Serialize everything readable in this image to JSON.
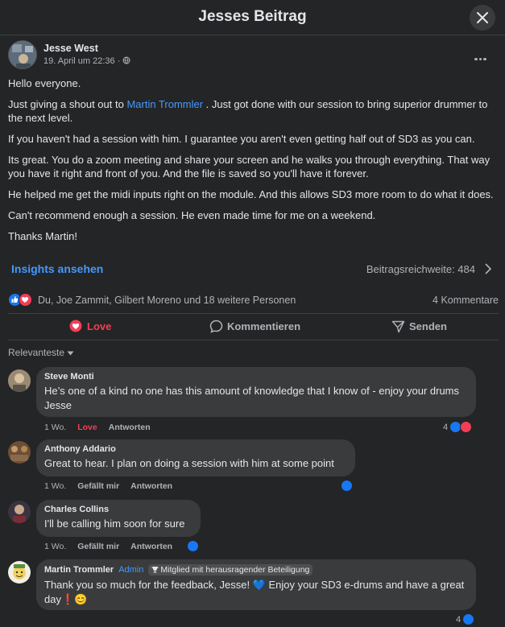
{
  "dialog": {
    "title": "Jesses Beitrag"
  },
  "post": {
    "author": "Jesse West",
    "time": "19. April um 22:36 ·",
    "paragraphs": {
      "p1": "Hello everyone.",
      "p2_before": "Just giving a shout out to ",
      "p2_mention": "Martin Trommler",
      "p2_after": " . Just got done with our session to bring superior drummer to the next level.",
      "p3": "If you haven't had a session with him. I guarantee you aren't even getting half out of SD3 as you can.",
      "p4": "Its great. You do a zoom meeting and share your screen and he walks you through everything. That way you have it right and front of you. And the file is saved so you'll have it forever.",
      "p5": "He helped me get the midi inputs right on the module. And this allows SD3 more room to do what it does.",
      "p6": "Can't recommend enough a session. He even made time for me on a weekend.",
      "p7": "Thanks Martin!"
    },
    "insights_label": "Insights ansehen",
    "reach_label": "Beitragsreichweite: 484",
    "reactions_text": "Du, Joe Zammit, Gilbert Moreno und 18 weitere Personen",
    "comments_count": "4 Kommentare"
  },
  "actions": {
    "love": "Love",
    "comment": "Kommentieren",
    "send": "Senden"
  },
  "sort_label": "Relevanteste",
  "comments": [
    {
      "name": "Steve Monti",
      "text": "He’s one of a kind no one has this amount of knowledge that I know of - enjoy your drums Jesse",
      "time": "1 Wo.",
      "reaction": "Love",
      "reply": "Antworten",
      "react_count": "4"
    },
    {
      "name": "Anthony Addario",
      "text": "Great to hear. I plan on doing a session with him at some point",
      "time": "1 Wo.",
      "reaction": "Gefällt mir",
      "reply": "Antworten"
    },
    {
      "name": "Charles Collins",
      "text": "I'll be calling him soon for sure",
      "time": "1 Wo.",
      "reaction": "Gefällt mir",
      "reply": "Antworten"
    },
    {
      "name": "Martin Trommler",
      "admin": "Admin",
      "badge": "Mitglied mit herausragender Beteiligung",
      "text": "Thank you so much for the feedback, Jesse! 💙 Enjoy your SD3 e-drums and have a great day❗😊",
      "react_count": "4"
    }
  ],
  "colors": {
    "background": "#242526",
    "bubble": "#3a3b3c",
    "accent": "#4599ff",
    "love": "#f33e58",
    "like": "#1877f2"
  }
}
